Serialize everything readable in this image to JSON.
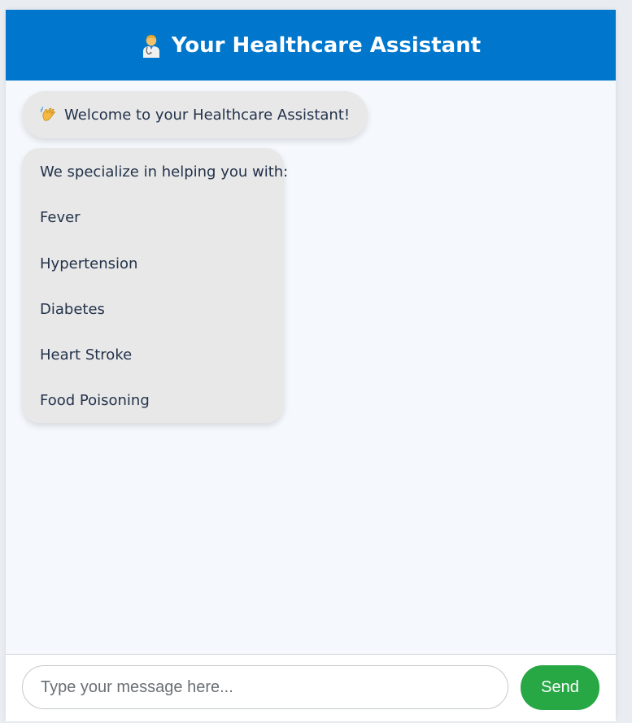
{
  "header": {
    "title": "Your Healthcare Assistant",
    "icon": "doctor-icon",
    "background": "#0077cc"
  },
  "messages": {
    "welcome": {
      "icon": "waving-hand-icon",
      "text": "Welcome to your Healthcare Assistant!"
    },
    "specialties": {
      "intro": "We specialize in helping you with:",
      "items": [
        "Fever",
        "Hypertension",
        "Diabetes",
        "Heart Stroke",
        "Food Poisoning"
      ]
    }
  },
  "composer": {
    "placeholder": "Type your message here...",
    "value": "",
    "send_label": "Send",
    "send_color": "#28a745"
  }
}
